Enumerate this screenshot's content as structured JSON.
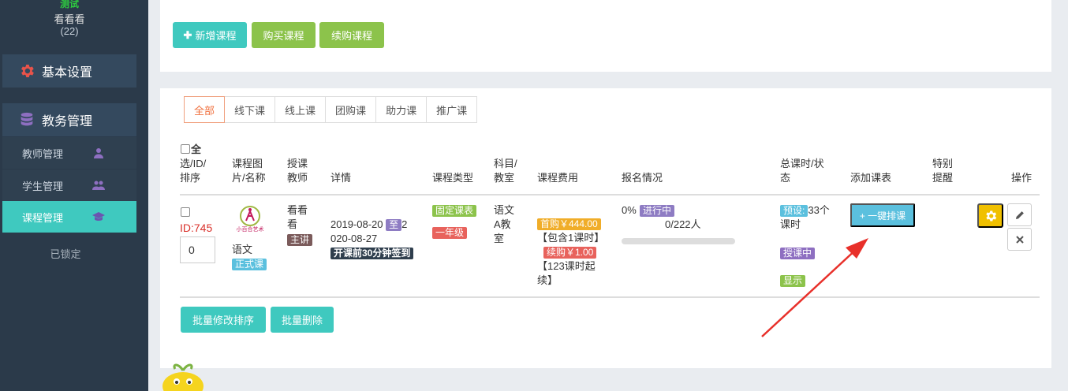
{
  "sidebar": {
    "user_status": "测试",
    "user_name": "看看看",
    "user_count": "(22)",
    "basic_settings": "基本设置",
    "edu_admin": "教务管理",
    "teacher_mgmt": "教师管理",
    "student_mgmt": "学生管理",
    "course_mgmt": "课程管理",
    "locked": "已锁定"
  },
  "toolbar": {
    "add_course": "新增课程",
    "buy_course": "购买课程",
    "renew_course": "续购课程"
  },
  "tabs": [
    {
      "label": "全部",
      "active": true
    },
    {
      "label": "线下课",
      "active": false
    },
    {
      "label": "线上课",
      "active": false
    },
    {
      "label": "团购课",
      "active": false
    },
    {
      "label": "助力课",
      "active": false
    },
    {
      "label": "推广课",
      "active": false
    }
  ],
  "table": {
    "headers": {
      "select_l1": "全",
      "select_l2": "选/ID/",
      "select_l3": "排序",
      "image_l1": "课程图",
      "image_l2": "片/名称",
      "teacher_l1": "授课",
      "teacher_l2": "教师",
      "details": "详情",
      "type": "课程类型",
      "subject_l1": "科目/",
      "subject_l2": "教室",
      "fee": "课程费用",
      "enroll": "报名情况",
      "total_l1": "总课时/状",
      "total_l2": "态",
      "add_schedule": "添加课表",
      "reminder_l1": "特别",
      "reminder_l2": "提醒",
      "actions": "操作"
    },
    "row": {
      "id": "ID:745",
      "sort_value": "0",
      "logo_text": "小百合艺术",
      "course_name": "语文",
      "course_badge": "正式课",
      "teacher_l1": "看看",
      "teacher_l2": "看",
      "teacher_badge": "主讲",
      "date_start": "2019-08-20",
      "date_to": "至",
      "date_end_a": "2",
      "date_end_b": "020-08-27",
      "checkin_badge": "开课前30分钟签到",
      "type_badge1": "固定课表",
      "type_badge2": "一年级",
      "subject_l1": "语文",
      "subject_l2": "A教",
      "subject_l3": "室",
      "fee_first": "首购￥444.00",
      "fee_first_note": "【包含1课时】",
      "fee_renew": "续购￥1.00",
      "fee_renew_note_l1": "【123课时起",
      "fee_renew_note_l2": "续】",
      "enroll_percent": "0%",
      "enroll_progress": 0,
      "enroll_status": "进行中",
      "enroll_count": "0/222人",
      "preset_badge": "预设:",
      "preset_value": "33个",
      "preset_unit": "课时",
      "teaching_badge": "授课中",
      "display_badge": "显示",
      "schedule_button": "+ 一键排课"
    }
  },
  "batch": {
    "modify_sort": "批量修改排序",
    "delete": "批量删除"
  },
  "colors": {
    "accent": "#3fc9bf",
    "green": "#8cc34b",
    "sidebar": "#2b3a4a",
    "warning": "#f0c000",
    "arrow": "#e8302a"
  }
}
